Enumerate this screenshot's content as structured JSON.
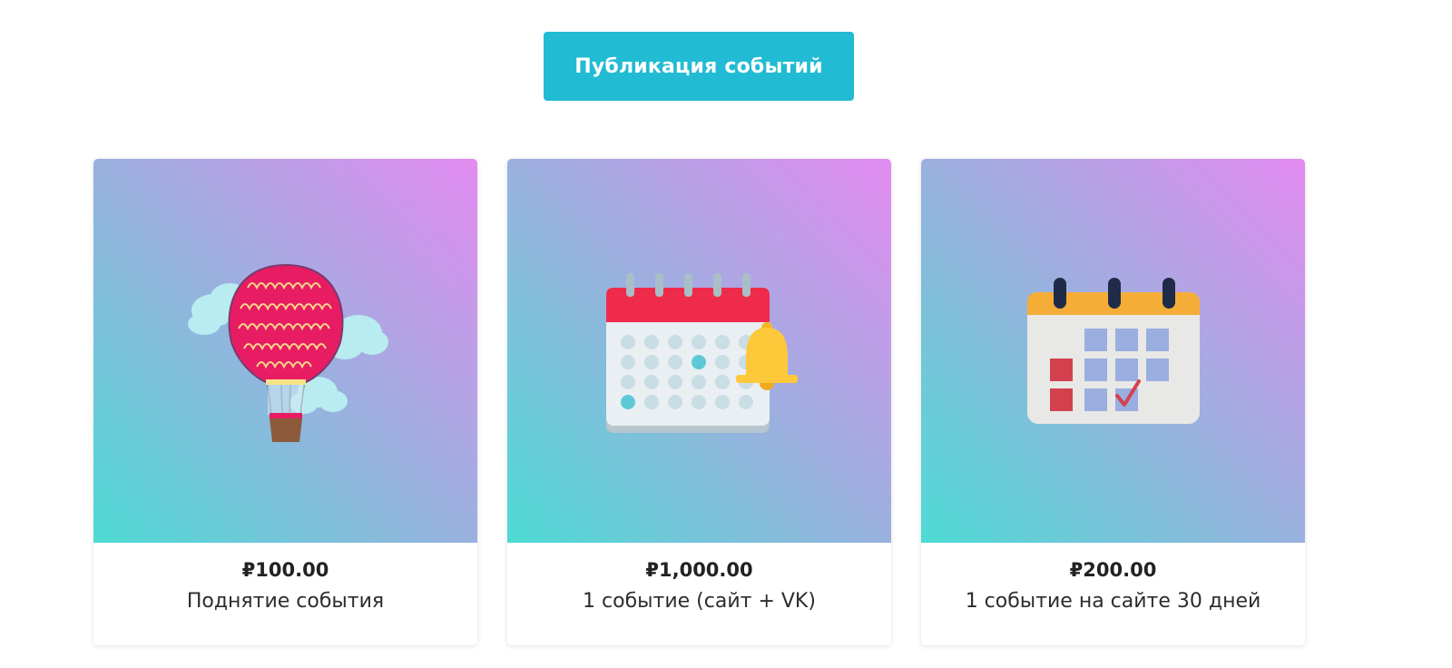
{
  "header": {
    "button_label": "Публикация событий",
    "button_color": "#21bbd3"
  },
  "products": [
    {
      "price": "₽100.00",
      "title": "Поднятие события",
      "icon": "hot-air-balloon-icon"
    },
    {
      "price": "₽1,000.00",
      "title": "1 событие (сайт + VK)",
      "icon": "calendar-bell-icon"
    },
    {
      "price": "₽200.00",
      "title": "1 событие на сайте 30 дней",
      "icon": "calendar-check-icon"
    }
  ],
  "colors": {
    "gradient_start": "#4edbd4",
    "gradient_mid": "#97b2de",
    "gradient_end": "#e38bf0"
  }
}
